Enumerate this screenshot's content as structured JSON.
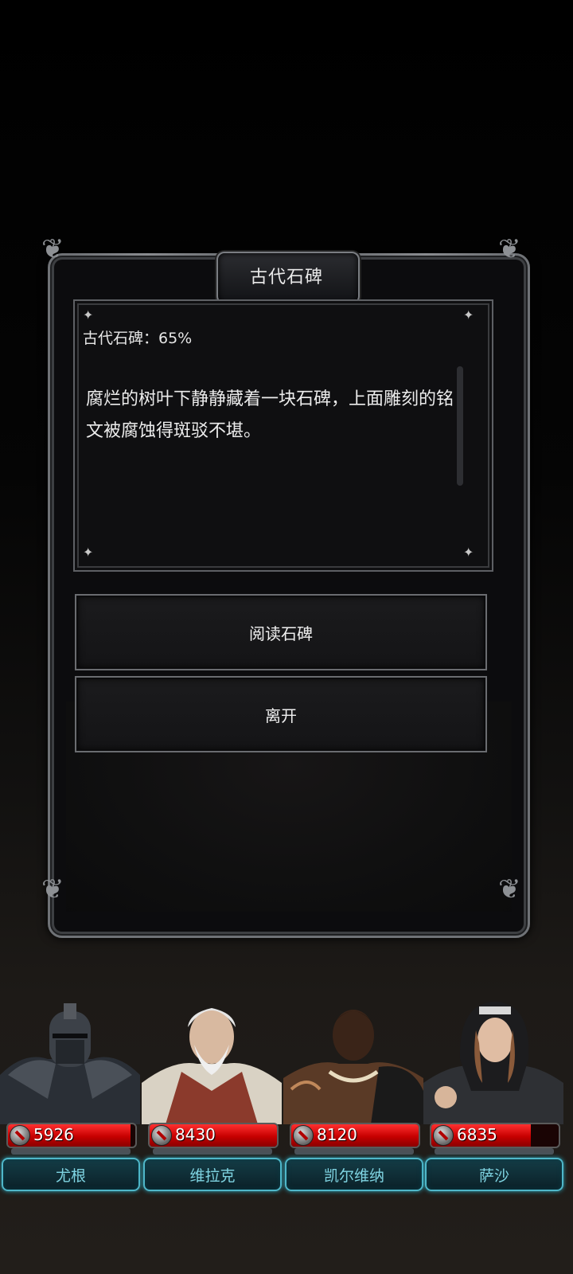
{
  "dialog": {
    "title": "古代石碑",
    "progress_label": "古代石碑：65%",
    "description": "腐烂的树叶下静静藏着一块石碑，上面雕刻的铭文被腐蚀得斑驳不堪。"
  },
  "actions": {
    "read_label": "阅读石碑",
    "leave_label": "离开"
  },
  "party": [
    {
      "name": "尤根",
      "hp": "5926",
      "hp_fraction": 0.96
    },
    {
      "name": "维拉克",
      "hp": "8430",
      "hp_fraction": 1.0
    },
    {
      "name": "凯尔维纳",
      "hp": "8120",
      "hp_fraction": 1.0
    },
    {
      "name": "萨沙",
      "hp": "6835",
      "hp_fraction": 0.78
    }
  ],
  "colors": {
    "hp_red": "#d10000",
    "name_plate_border": "#4fb7c9",
    "dialog_border": "#6f7276"
  }
}
